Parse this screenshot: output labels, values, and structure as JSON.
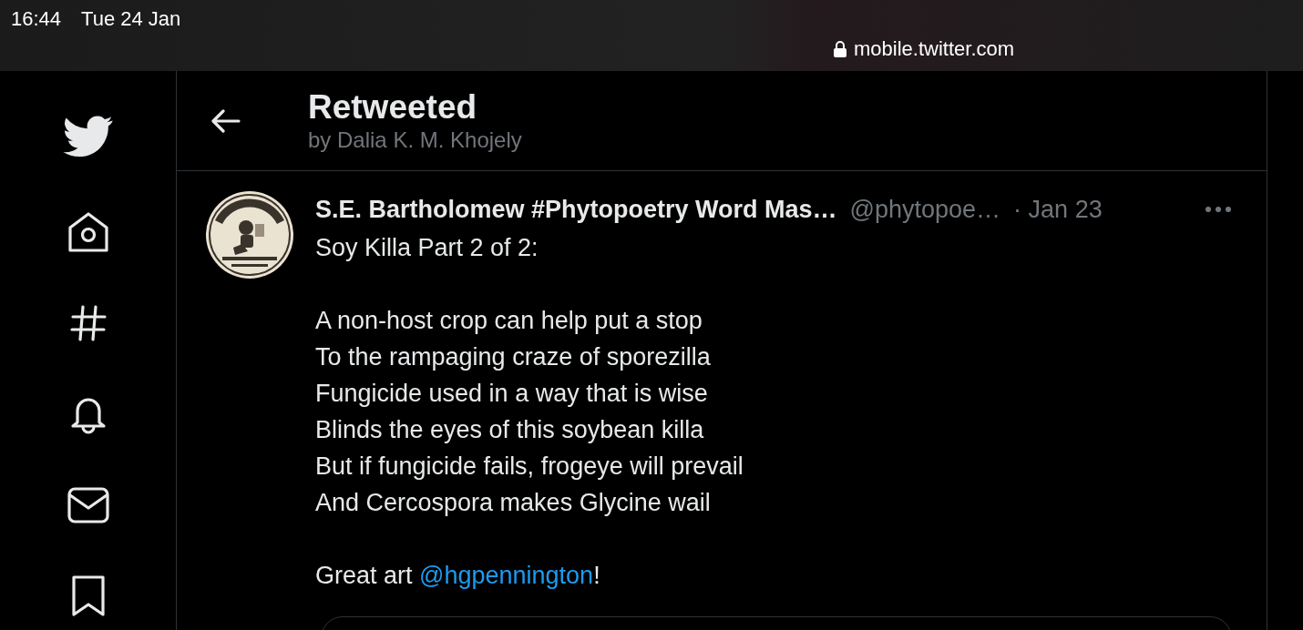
{
  "status_bar": {
    "time": "16:44",
    "date": "Tue 24 Jan",
    "url": "mobile.twitter.com"
  },
  "header": {
    "title": "Retweeted",
    "subtitle": "by Dalia K. M. Khojely"
  },
  "tweet": {
    "author": "S.E. Bartholomew #Phytopoetry Word Mas…",
    "handle": "@phytopoe…",
    "time": "· Jan 23",
    "intro": "Soy Killa Part 2 of 2:",
    "poem": [
      "A non-host crop can help put a stop",
      "To the rampaging craze of sporezilla",
      "Fungicide used in a way that is wise",
      "Blinds the eyes of this soybean killa",
      "But if fungicide fails, frogeye will prevail",
      "And Cercospora makes Glycine wail"
    ],
    "closing": {
      "before": "Great art ",
      "mention": "@hgpennington",
      "after": "!"
    }
  }
}
